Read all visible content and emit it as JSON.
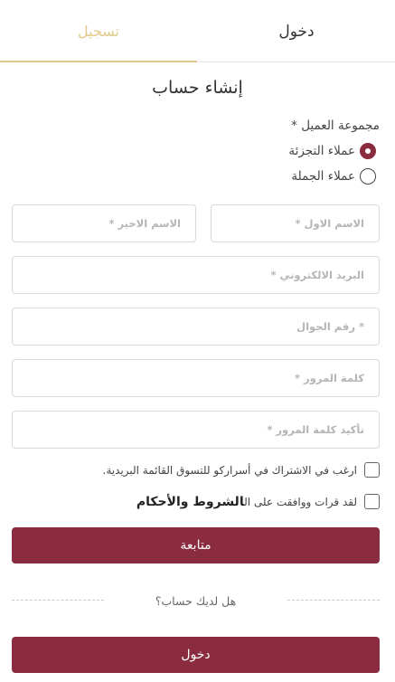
{
  "tabs": {
    "login_label": "دخول",
    "register_label": "تسجيل"
  },
  "form": {
    "title": "إنشاء حساب",
    "customer_group": {
      "label": "مجموعة العميل *",
      "options": [
        {
          "label": "عملاء التجزئة",
          "selected": true
        },
        {
          "label": "عملاء الجملة",
          "selected": false
        }
      ]
    },
    "fields": {
      "first_name_placeholder": "الاسم الاول *",
      "last_name_placeholder": "الاسم الاخير *",
      "email_placeholder": "البريد الالكتروني *",
      "mobile_placeholder": "رقم الجوال *",
      "password_placeholder": "كلمة المرور *",
      "confirm_password_placeholder": "تأكيد كلمة المرور *"
    },
    "newsletter_label": "ارغب في الاشتراك في أسراركو للتسوق القائمة البريدية.",
    "terms_prefix": "لقد قرات ووافقت على ال",
    "terms_link": "الشروط والأحكام",
    "continue_button": "متابعة",
    "have_account_text": "هل لديك حساب؟",
    "login_button": "دخول"
  },
  "colors": {
    "accent": "#8a2b3f",
    "tab_active": "#e1c98a"
  }
}
